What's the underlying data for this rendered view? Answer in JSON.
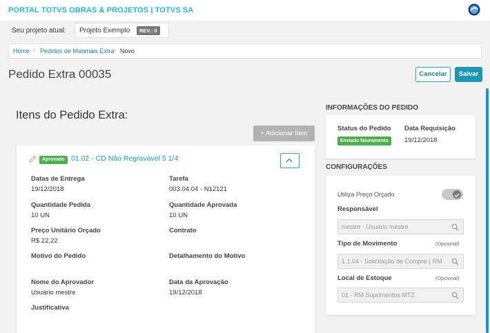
{
  "header": {
    "brand": "PORTAL TOTVS OBRAS & PROJETOS | TOTVS SA"
  },
  "project": {
    "label": "Seu projeto atual:",
    "name": "Projeto Exemplo",
    "rev": "REV.: 0"
  },
  "breadcrumb": [
    "Home",
    "Pedidos de Materiais Extra",
    "Novo"
  ],
  "page": {
    "title": "Pedido Extra 00035",
    "cancel_label": "Cancelar",
    "save_label": "Salvar"
  },
  "items": {
    "heading": "Itens do Pedido Extra:",
    "add_label": "+ Adicionar Item",
    "card": {
      "status": "Aprovado",
      "name": "01.02 - CD Não Regravável 5 1/4",
      "fields": {
        "datas_entrega_label": "Datas de Entrega",
        "datas_entrega": "19/12/2018",
        "tarefa_label": "Tarefa",
        "tarefa": "003.04.04 - N12121",
        "qtd_pedida_label": "Quantidade Pedida",
        "qtd_pedida": "10 UN",
        "qtd_aprovada_label": "Quantidade Aprovada",
        "qtd_aprovada": "10 UN",
        "preco_label": "Preço Unitário Orçado",
        "preco": "R$ 22,22",
        "contrato_label": "Contrato",
        "motivo_label": "Motivo do Pedido",
        "detalhamento_label": "Detalhamento do Motivo",
        "aprovador_label": "Nome do Aprovador",
        "aprovador": "Usuário mestre",
        "data_aprov_label": "Data da Aprovação",
        "data_aprov": "19/12/2018",
        "justificativa_label": "Justificativa"
      }
    }
  },
  "info": {
    "heading": "INFORMAÇÕES DO PEDIDO",
    "status_label": "Status do Pedido",
    "status_value": "Enviado faturamento",
    "data_label": "Data Requisição",
    "data_value": "19/12/2018"
  },
  "config": {
    "heading": "CONFIGURAÇÕES",
    "preco_orcado_label": "Utiliza Preço Orçado",
    "preco_orcado_on": true,
    "responsavel_label": "Responsável",
    "responsavel_value": "mestre - Usuário mestre",
    "tipo_mov_label": "Tipo de Movimento",
    "tipo_mov_optional": "(Opcional)",
    "tipo_mov_value": "1.1.04 - Solicitação de Compra ( RM",
    "local_label": "Local de Estoque",
    "local_optional": "(Opcional)",
    "local_value": "01 - RM Suprimentos MTZ"
  },
  "colors": {
    "accent": "#1e96b0",
    "approved": "#4cae4c",
    "brand": "#29b6c5"
  }
}
